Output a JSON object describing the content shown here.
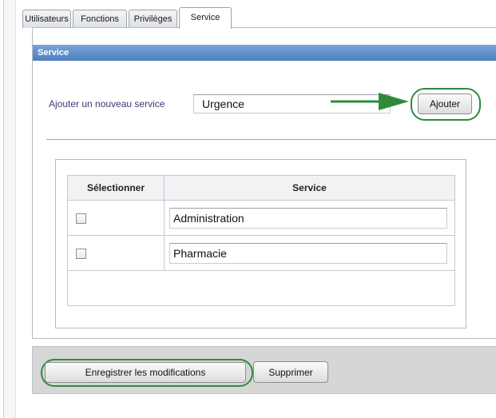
{
  "tabs": [
    {
      "label": "Utilisateurs",
      "active": false
    },
    {
      "label": "Fonctions",
      "active": false
    },
    {
      "label": "Privilèges",
      "active": false
    },
    {
      "label": "Service",
      "active": true
    }
  ],
  "panel": {
    "title": "Service"
  },
  "add_service": {
    "label": "Ajouter un nouveau service",
    "value": "Urgence",
    "button_label": "Ajouter"
  },
  "table": {
    "headers": [
      "Sélectionner",
      "Service"
    ],
    "rows": [
      {
        "selected": false,
        "service": "Administration"
      },
      {
        "selected": false,
        "service": "Pharmacie"
      }
    ]
  },
  "footer": {
    "save_label": "Enregistrer les modifications",
    "delete_label": "Supprimer"
  },
  "colors": {
    "header_blue": "#5c8ccb",
    "highlight_green": "#2e8b3a"
  }
}
